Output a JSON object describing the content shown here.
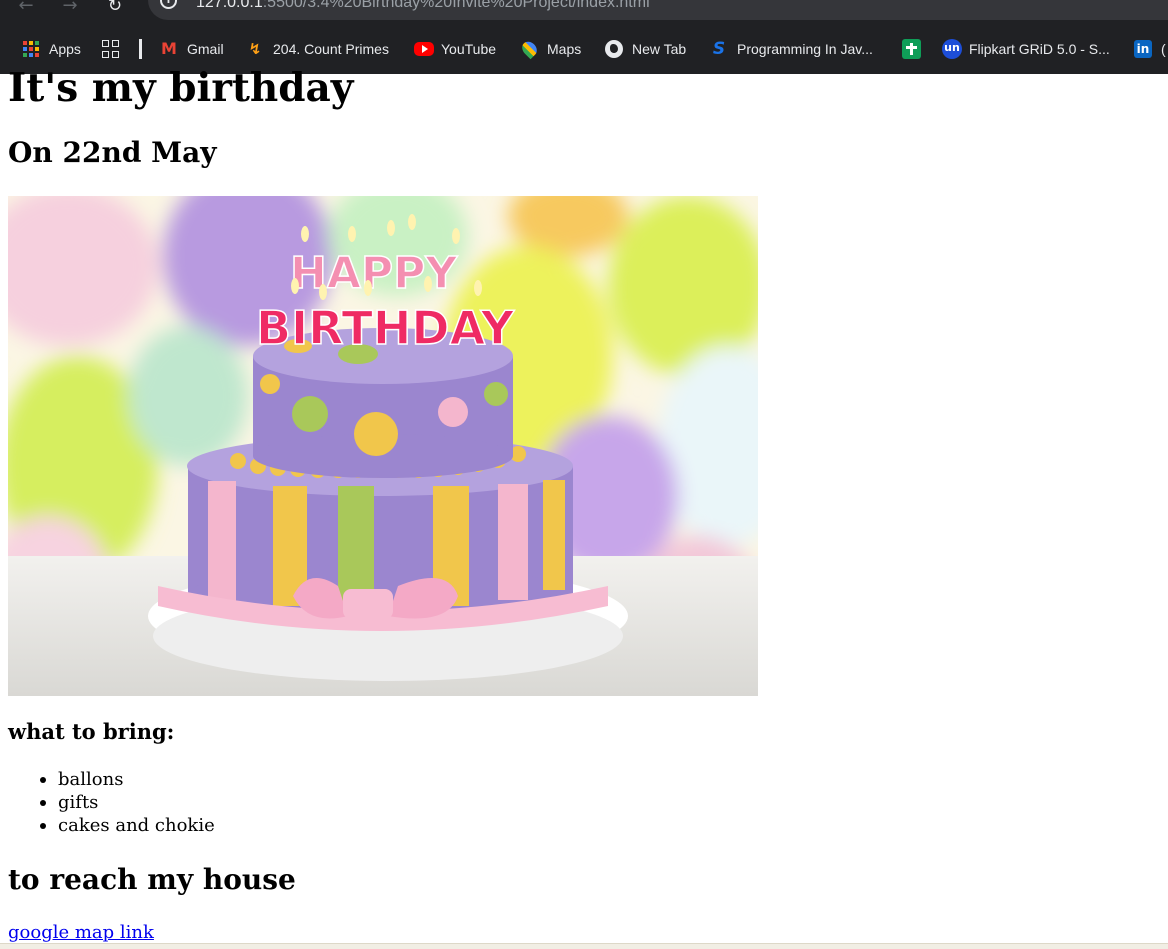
{
  "browser": {
    "url_host": "127.0.0.1",
    "url_path": ":5500/3.4%20Birthday%20Invite%20Project/index.html",
    "bookmarks": [
      {
        "label": "Apps",
        "icon": "apps-grid-icon"
      },
      {
        "label": "",
        "icon": "tab-groups-icon"
      },
      {
        "label": "Gmail",
        "icon": "gmail-icon"
      },
      {
        "label": "204. Count Primes",
        "icon": "leetcode-icon"
      },
      {
        "label": "YouTube",
        "icon": "youtube-icon"
      },
      {
        "label": "Maps",
        "icon": "maps-icon"
      },
      {
        "label": "New Tab",
        "icon": "globe-icon"
      },
      {
        "label": "Programming In Jav...",
        "icon": "swayam-icon"
      },
      {
        "label": "",
        "icon": "sheets-icon"
      },
      {
        "label": "Flipkart GRiD 5.0 - S...",
        "icon": "unstop-icon"
      },
      {
        "label": "(",
        "icon": "linkedin-icon"
      }
    ]
  },
  "page": {
    "title": "It's my birthday",
    "date": "On 22nd May",
    "cake_letters_top": "HAPPY",
    "cake_letters_bottom": "BIRTHDAY",
    "bring_heading": "what to bring:",
    "items": [
      "ballons",
      "gifts",
      "cakes and chokie"
    ],
    "reach_heading": "to reach my house",
    "map_link": "google map link"
  },
  "colors": {
    "chrome_bg": "#202124",
    "link": "#0000ee",
    "cake_purple": "#9b86cf",
    "cake_pink": "#f4b6cd",
    "cake_yellow": "#f1c64b",
    "cake_green": "#a9c85a"
  }
}
